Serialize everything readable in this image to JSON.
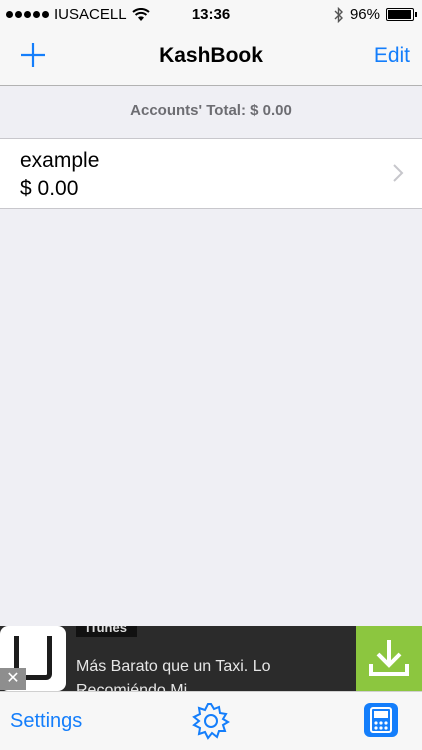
{
  "status": {
    "carrier": "IUSACELL",
    "time": "13:36",
    "battery": "96%",
    "battery_level": 0.96,
    "icons": [
      "signal-dots",
      "wifi-icon",
      "bluetooth-icon",
      "battery-icon"
    ]
  },
  "nav": {
    "title": "KashBook",
    "edit_label": "Edit",
    "add_icon": "plus-icon"
  },
  "summary": {
    "total_label": "Accounts' Total: $ 0.00"
  },
  "accounts": [
    {
      "name": "example",
      "balance": "$ 0.00"
    }
  ],
  "ad": {
    "tag": "iTunes",
    "line1": "Más Barato que un Taxi. Lo",
    "line2": "Recomiéndo Mi...",
    "close": "✕",
    "download_icon": "download-icon",
    "colors": {
      "download_bg": "#8cc63f",
      "banner_bg": "#2b2b2b"
    }
  },
  "tabbar": {
    "settings_label": "Settings",
    "gear_icon": "gear-icon",
    "app_icon": "app-icon"
  },
  "colors": {
    "accent": "#147efb",
    "background": "#efeff4"
  }
}
